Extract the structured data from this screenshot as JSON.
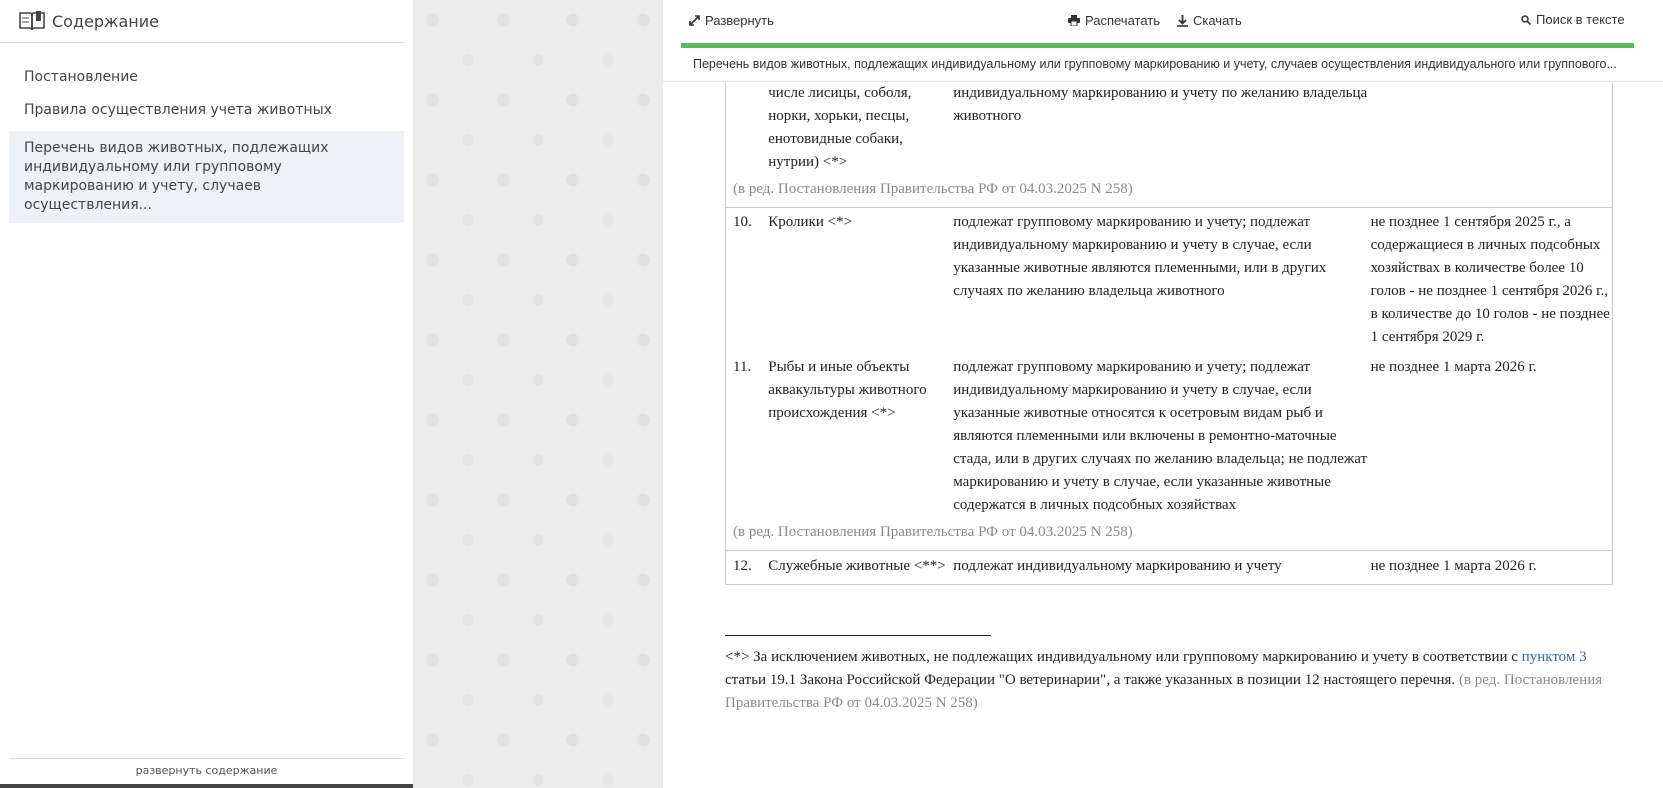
{
  "sidebar": {
    "title": "Содержание",
    "items": [
      {
        "label": "Постановление"
      },
      {
        "label": "Правила осуществления учета животных"
      },
      {
        "label": "Перечень видов животных, подлежащих индивидуальному или групповому маркированию и учету, случаев осуществления..."
      }
    ],
    "footer": "развернуть содержание"
  },
  "toolbar": {
    "expand": "Развернуть",
    "print": "Распечатать",
    "download": "Скачать",
    "search": "Поиск в тексте"
  },
  "doc_title": "Перечень видов животных, подлежащих индивидуальному или групповому маркированию и учету, случаев осуществления индивидуального или группового...",
  "rows": [
    {
      "num": "",
      "name": "числе лисицы, соболя, норки, хорьки, песцы, енотовидные собаки, нутрии) <*>",
      "desc": "индивидуальному маркированию и учету по желанию владельца животного",
      "term": "",
      "note": "(в ред. Постановления Правительства РФ от 04.03.2025 N 258)"
    },
    {
      "num": "10.",
      "name": "Кролики <*>",
      "desc": "подлежат групповому маркированию и учету; подлежат индивидуальному маркированию и учету в случае, если указанные животные являются племенными, или в других случаях по желанию владельца животного",
      "term": "не позднее 1 сентября 2025 г., а содержащиеся в личных подсобных хозяйствах в количестве более 10 голов - не позднее 1 сентября 2026 г., в количестве до 10 голов - не позднее 1 сентября 2029 г."
    },
    {
      "num": "11.",
      "name": "Рыбы и иные объекты аквакультуры животного происхождения <*>",
      "desc": "подлежат групповому маркированию и учету; подлежат индивидуальному маркированию и учету в случае, если указанные животные относятся к осетровым видам рыб и являются племенными или включены в ремонтно-маточные стада, или в других случаях по желанию владельца; не подлежат маркированию и учету в случае, если указанные животные содержатся в личных подсобных хозяйствах",
      "term": "не позднее 1 марта 2026 г.",
      "note": "(в ред. Постановления Правительства РФ от 04.03.2025 N 258)"
    },
    {
      "num": "12.",
      "name": "Служебные животные <**>",
      "desc": "подлежат индивидуальному маркированию и учету",
      "term": "не позднее 1 марта 2026 г."
    }
  ],
  "footnote": {
    "part1": "<*> За исключением животных, не подлежащих индивидуальному или групповому маркированию и учету в соответствии с",
    "link": "пунктом 3",
    "part2": "статьи 19.1 Закона Российской Федерации \"О ветеринарии\", а также указанных в позиции 12 настоящего перечня.",
    "note": "(в ред. Постановления Правительства РФ от 04.03.2025 N 258)"
  }
}
